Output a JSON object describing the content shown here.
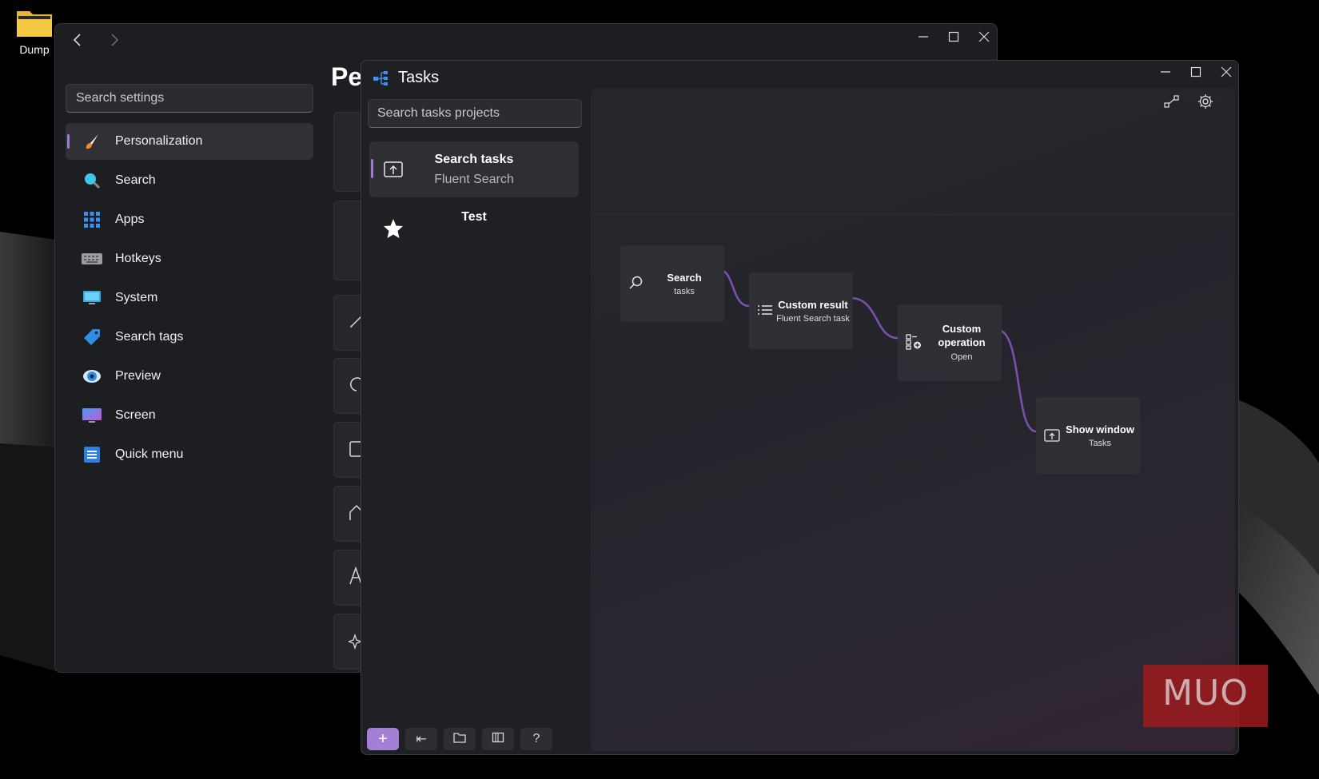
{
  "desktop": {
    "folder_label": "Dump"
  },
  "settings_window": {
    "heading": "Pe",
    "search_placeholder": "Search settings",
    "sidebar": {
      "items": [
        {
          "label": "Personalization",
          "icon": "paintbrush-icon",
          "active": true
        },
        {
          "label": "Search",
          "icon": "magnifier-icon",
          "active": false
        },
        {
          "label": "Apps",
          "icon": "apps-grid-icon",
          "active": false
        },
        {
          "label": "Hotkeys",
          "icon": "keyboard-icon",
          "active": false
        },
        {
          "label": "System",
          "icon": "monitor-icon",
          "active": false
        },
        {
          "label": "Search tags",
          "icon": "tag-icon",
          "active": false
        },
        {
          "label": "Preview",
          "icon": "eye-icon",
          "active": false
        },
        {
          "label": "Screen",
          "icon": "screen-icon",
          "active": false
        },
        {
          "label": "Quick menu",
          "icon": "list-icon",
          "active": false
        }
      ]
    }
  },
  "tasks_window": {
    "title": "Tasks",
    "search_placeholder": "Search tasks projects",
    "tasks": [
      {
        "name": "Search tasks",
        "subtitle": "Fluent Search",
        "icon": "show-window-icon",
        "active": true
      },
      {
        "name": "Test",
        "subtitle": "",
        "icon": "star-icon",
        "active": false
      }
    ],
    "toolbar": {
      "add": "+",
      "collapse": "⇤",
      "help": "?"
    },
    "nodes": [
      {
        "title": "Search",
        "subtitle": "tasks",
        "icon": "search-icon"
      },
      {
        "title": "Custom result",
        "subtitle": "Fluent Search task",
        "icon": "list-icon"
      },
      {
        "title": "Custom operation",
        "subtitle": "Open",
        "icon": "operation-icon"
      },
      {
        "title": "Show window",
        "subtitle": "Tasks",
        "icon": "show-window-icon"
      }
    ],
    "connector_color": "#7b4fb0"
  },
  "watermark": "MUO",
  "colors": {
    "accent": "#a47fd6",
    "window_bg": "#1f2024",
    "watermark_red": "#9e1b1f"
  }
}
